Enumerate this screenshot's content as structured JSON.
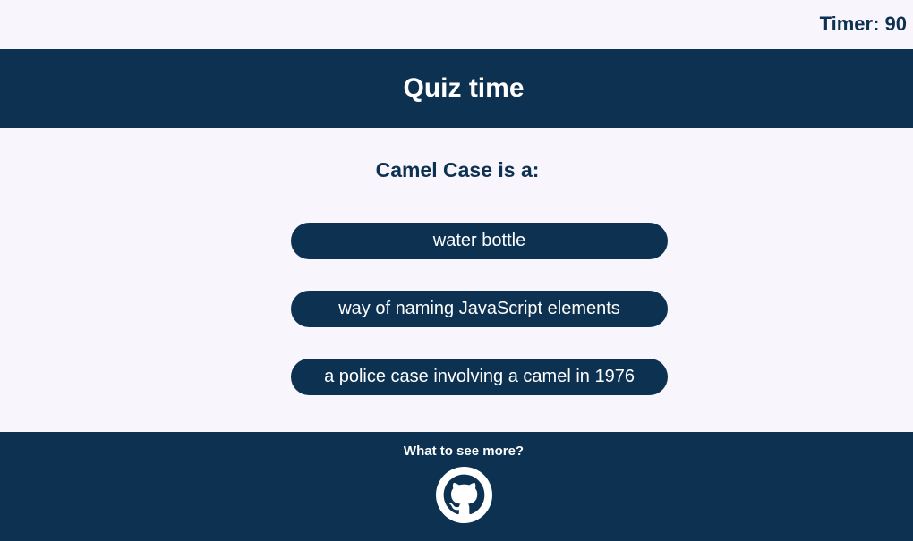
{
  "timer": {
    "label": "Timer: 90"
  },
  "header": {
    "title": "Quiz time"
  },
  "quiz": {
    "question": "Camel Case is a:",
    "answers": [
      "water bottle",
      "way of naming JavaScript elements",
      "a police case involving a camel in 1976"
    ]
  },
  "footer": {
    "text": "What to see more?",
    "link_icon": "github-icon"
  },
  "colors": {
    "primary": "#0d3150",
    "background": "#f8f5fd",
    "text_on_primary": "#ffffff"
  }
}
